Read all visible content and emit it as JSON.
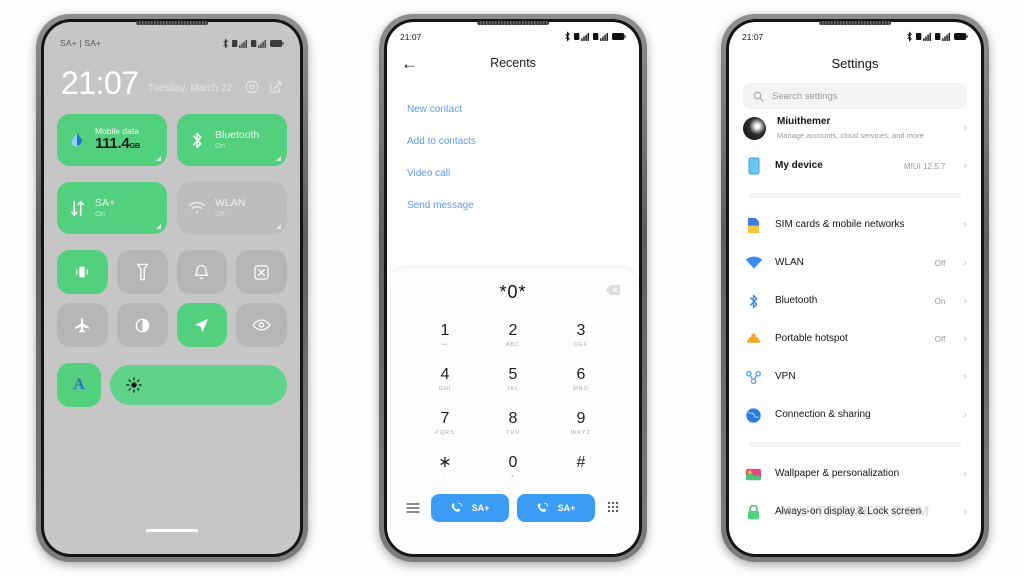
{
  "phone1": {
    "name": "control-center",
    "status": {
      "carrier": "SA+ | SA+",
      "network_badge": "4G"
    },
    "clock": {
      "time": "21:07",
      "date": "Tuesday, March 22"
    },
    "big_tiles": [
      {
        "title": "Mobile data",
        "value": "111.4",
        "unit": "GB",
        "icon": "data-drop-icon",
        "state": "on"
      },
      {
        "title": "Bluetooth",
        "sub": "On",
        "icon": "bluetooth-icon",
        "state": "on"
      },
      {
        "title": "SA+",
        "sub": "On",
        "icon": "data-transfer-icon",
        "state": "on"
      },
      {
        "title": "WLAN",
        "sub": "Off",
        "icon": "wifi-icon",
        "state": "off"
      }
    ],
    "square_tiles": [
      {
        "icon": "vibrate-icon",
        "state": "on"
      },
      {
        "icon": "flashlight-icon",
        "state": "off"
      },
      {
        "icon": "bell-icon",
        "state": "off"
      },
      {
        "icon": "screenshot-icon",
        "state": "off"
      },
      {
        "icon": "airplane-icon",
        "state": "off"
      },
      {
        "icon": "dark-mode-icon",
        "state": "off"
      },
      {
        "icon": "location-icon",
        "state": "on"
      },
      {
        "icon": "eye-care-icon",
        "state": "off"
      }
    ],
    "auto_brightness_label": "A",
    "brightness_icon": "sun-icon"
  },
  "phone2": {
    "name": "dialer",
    "status": {
      "time": "21:07"
    },
    "header": {
      "back": "←",
      "title": "Recents"
    },
    "links": [
      {
        "label": "New contact"
      },
      {
        "label": "Add to contacts"
      },
      {
        "label": "Video call"
      },
      {
        "label": "Send message"
      }
    ],
    "dialpad": {
      "number": "*0*",
      "backspace_icon": "backspace-icon",
      "keys": [
        {
          "digit": "1",
          "letters": "••"
        },
        {
          "digit": "2",
          "letters": "ABC"
        },
        {
          "digit": "3",
          "letters": "DEF"
        },
        {
          "digit": "4",
          "letters": "GHI"
        },
        {
          "digit": "5",
          "letters": "JKL"
        },
        {
          "digit": "6",
          "letters": "MNO"
        },
        {
          "digit": "7",
          "letters": "PQRS"
        },
        {
          "digit": "8",
          "letters": "TUV"
        },
        {
          "digit": "9",
          "letters": "WXYZ"
        },
        {
          "digit": "∗",
          "letters": ","
        },
        {
          "digit": "0",
          "letters": "+"
        },
        {
          "digit": "#",
          "letters": ""
        }
      ]
    },
    "actions": {
      "menu_icon": "menu-icon",
      "call_sim1": "SA+",
      "call_sim2": "SA+",
      "keypad_icon": "keypad-icon"
    }
  },
  "phone3": {
    "name": "settings",
    "status": {
      "time": "21:07"
    },
    "title": "Settings",
    "search_placeholder": "Search settings",
    "groups": [
      {
        "rows": [
          {
            "label": "Miuithemer",
            "sub": "Manage accounts, cloud services, and more",
            "icon": "avatar",
            "value": ""
          },
          {
            "label": "My device",
            "sub": "",
            "icon": "device-icon",
            "value": "MIUI 12.5.7"
          }
        ]
      },
      {
        "rows": [
          {
            "label": "SIM cards & mobile networks",
            "sub": "",
            "icon": "sim-icon",
            "value": ""
          },
          {
            "label": "WLAN",
            "sub": "",
            "icon": "wifi-icon",
            "value": "Off"
          },
          {
            "label": "Bluetooth",
            "sub": "",
            "icon": "bluetooth-icon",
            "value": "On"
          },
          {
            "label": "Portable hotspot",
            "sub": "",
            "icon": "hotspot-icon",
            "value": "Off"
          },
          {
            "label": "VPN",
            "sub": "",
            "icon": "vpn-icon",
            "value": ""
          },
          {
            "label": "Connection & sharing",
            "sub": "",
            "icon": "globe-icon",
            "value": ""
          }
        ]
      },
      {
        "rows": [
          {
            "label": "Wallpaper & personalization",
            "sub": "",
            "icon": "wallpaper-icon",
            "value": ""
          },
          {
            "label": "Always-on display & Lock screen",
            "sub": "",
            "icon": "lock-icon",
            "value": ""
          }
        ]
      }
    ],
    "watermark": "MIUITHEMER.COM",
    "chevron": "›"
  },
  "colors": {
    "accent_green": "#52d07d",
    "cc_background": "#c6c6c6",
    "link_blue": "#5b9bf0",
    "call_blue": "#3a9cf5",
    "tile_off": "#b6b6b6"
  }
}
